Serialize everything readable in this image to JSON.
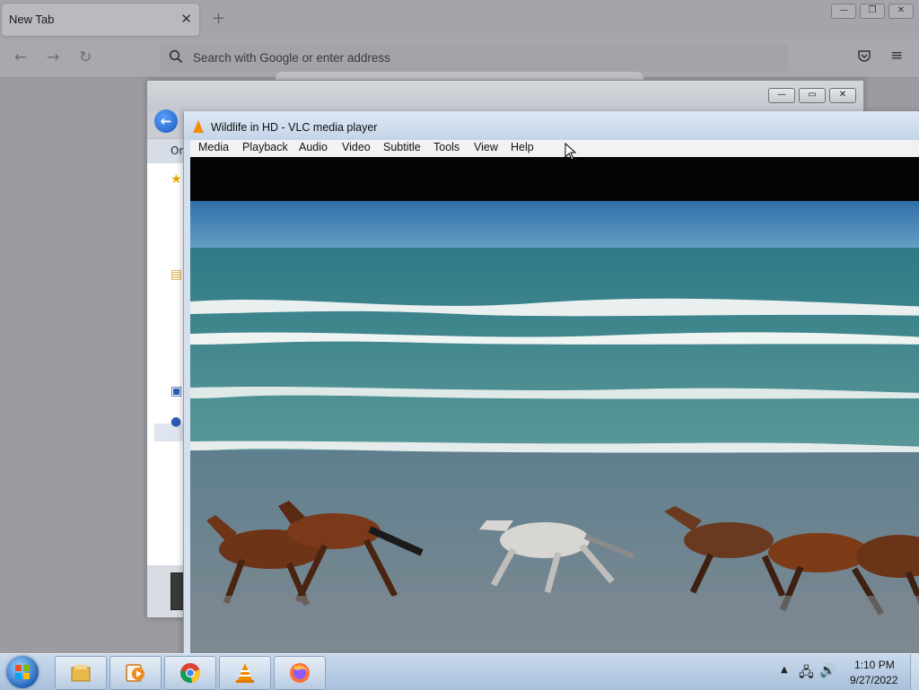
{
  "firefox": {
    "tab_title": "New Tab",
    "tab_close": "✕",
    "new_tab": "+",
    "back": "←",
    "forward": "→",
    "reload": "↻",
    "url_placeholder": "Search with Google or enter address",
    "pocket": "♡",
    "menu": "≡",
    "min": "—",
    "restore": "❐",
    "close": "✕"
  },
  "explorer": {
    "min": "—",
    "restore": "▭",
    "close": "✕",
    "back": "←",
    "organize_label": "Or"
  },
  "vlc": {
    "title": "Wildlife in HD - VLC media player",
    "menu": [
      "Media",
      "Playback",
      "Audio",
      "Video",
      "Subtitle",
      "Tools",
      "View",
      "Help"
    ]
  },
  "taskbar": {
    "tray_arrow": "▲",
    "network": "🖧",
    "volume": "🔊",
    "time": "1:10 PM",
    "date": "9/27/2022",
    "apps": [
      "file-explorer-icon",
      "media-player-icon",
      "chrome-icon",
      "vlc-icon",
      "firefox-icon"
    ]
  },
  "colors": {
    "vlc_orange": "#f28c00",
    "taskbar_blue": "#a9c0db",
    "sea": "#4a8a8c",
    "sand": "#6f7f8c"
  }
}
